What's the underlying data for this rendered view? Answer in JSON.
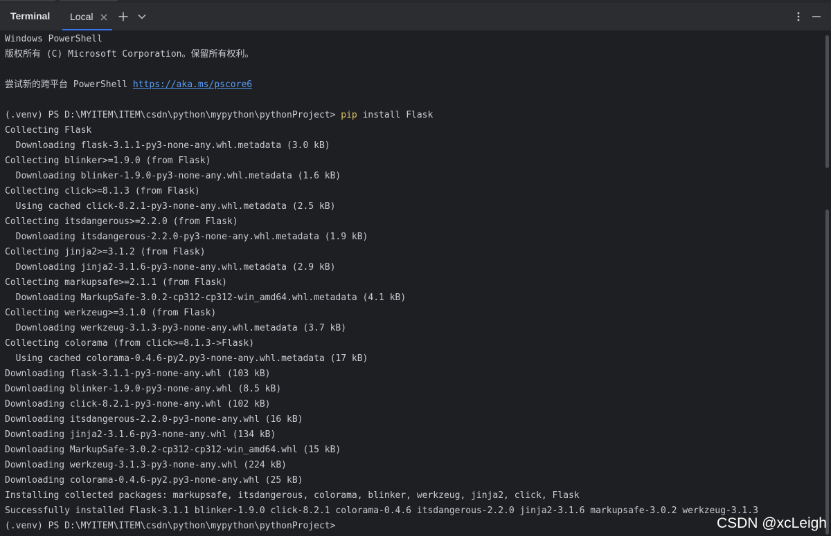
{
  "tool_window": {
    "title": "Terminal",
    "tabs": [
      {
        "label": "Local"
      }
    ]
  },
  "icons": {
    "close_tab": "close-icon",
    "new_tab": "plus-icon",
    "dropdown": "chevron-down-icon",
    "more": "more-vertical-icon",
    "minimize": "minimize-icon"
  },
  "colors": {
    "background": "#1e1f22",
    "tabbar": "#2b2d30",
    "text": "#c9ccd2",
    "link": "#589df6",
    "command": "#e0c066",
    "accent": "#3574f0"
  },
  "terminal": {
    "header": {
      "line1": "Windows PowerShell",
      "line2": "版权所有 (C) Microsoft Corporation。保留所有权利。",
      "try_prefix": "尝试新的跨平台 PowerShell ",
      "try_link": "https://aka.ms/pscore6"
    },
    "prompt1": {
      "text": "(.venv) PS D:\\MYITEM\\ITEM\\csdn\\python\\mypython\\pythonProject> ",
      "command": "pip",
      "args": " install Flask"
    },
    "output": [
      "Collecting Flask",
      "  Downloading flask-3.1.1-py3-none-any.whl.metadata (3.0 kB)",
      "Collecting blinker>=1.9.0 (from Flask)",
      "  Downloading blinker-1.9.0-py3-none-any.whl.metadata (1.6 kB)",
      "Collecting click>=8.1.3 (from Flask)",
      "  Using cached click-8.2.1-py3-none-any.whl.metadata (2.5 kB)",
      "Collecting itsdangerous>=2.2.0 (from Flask)",
      "  Downloading itsdangerous-2.2.0-py3-none-any.whl.metadata (1.9 kB)",
      "Collecting jinja2>=3.1.2 (from Flask)",
      "  Downloading jinja2-3.1.6-py3-none-any.whl.metadata (2.9 kB)",
      "Collecting markupsafe>=2.1.1 (from Flask)",
      "  Downloading MarkupSafe-3.0.2-cp312-cp312-win_amd64.whl.metadata (4.1 kB)",
      "Collecting werkzeug>=3.1.0 (from Flask)",
      "  Downloading werkzeug-3.1.3-py3-none-any.whl.metadata (3.7 kB)",
      "Collecting colorama (from click>=8.1.3->Flask)",
      "  Using cached colorama-0.4.6-py2.py3-none-any.whl.metadata (17 kB)",
      "Downloading flask-3.1.1-py3-none-any.whl (103 kB)",
      "Downloading blinker-1.9.0-py3-none-any.whl (8.5 kB)",
      "Downloading click-8.2.1-py3-none-any.whl (102 kB)",
      "Downloading itsdangerous-2.2.0-py3-none-any.whl (16 kB)",
      "Downloading jinja2-3.1.6-py3-none-any.whl (134 kB)",
      "Downloading MarkupSafe-3.0.2-cp312-cp312-win_amd64.whl (15 kB)",
      "Downloading werkzeug-3.1.3-py3-none-any.whl (224 kB)",
      "Downloading colorama-0.4.6-py2.py3-none-any.whl (25 kB)",
      "Installing collected packages: markupsafe, itsdangerous, colorama, blinker, werkzeug, jinja2, click, Flask",
      "Successfully installed Flask-3.1.1 blinker-1.9.0 click-8.2.1 colorama-0.4.6 itsdangerous-2.2.0 jinja2-3.1.6 markupsafe-3.0.2 werkzeug-3.1.3"
    ],
    "prompt2": "(.venv) PS D:\\MYITEM\\ITEM\\csdn\\python\\mypython\\pythonProject>"
  },
  "watermark": "CSDN @xcLeigh"
}
